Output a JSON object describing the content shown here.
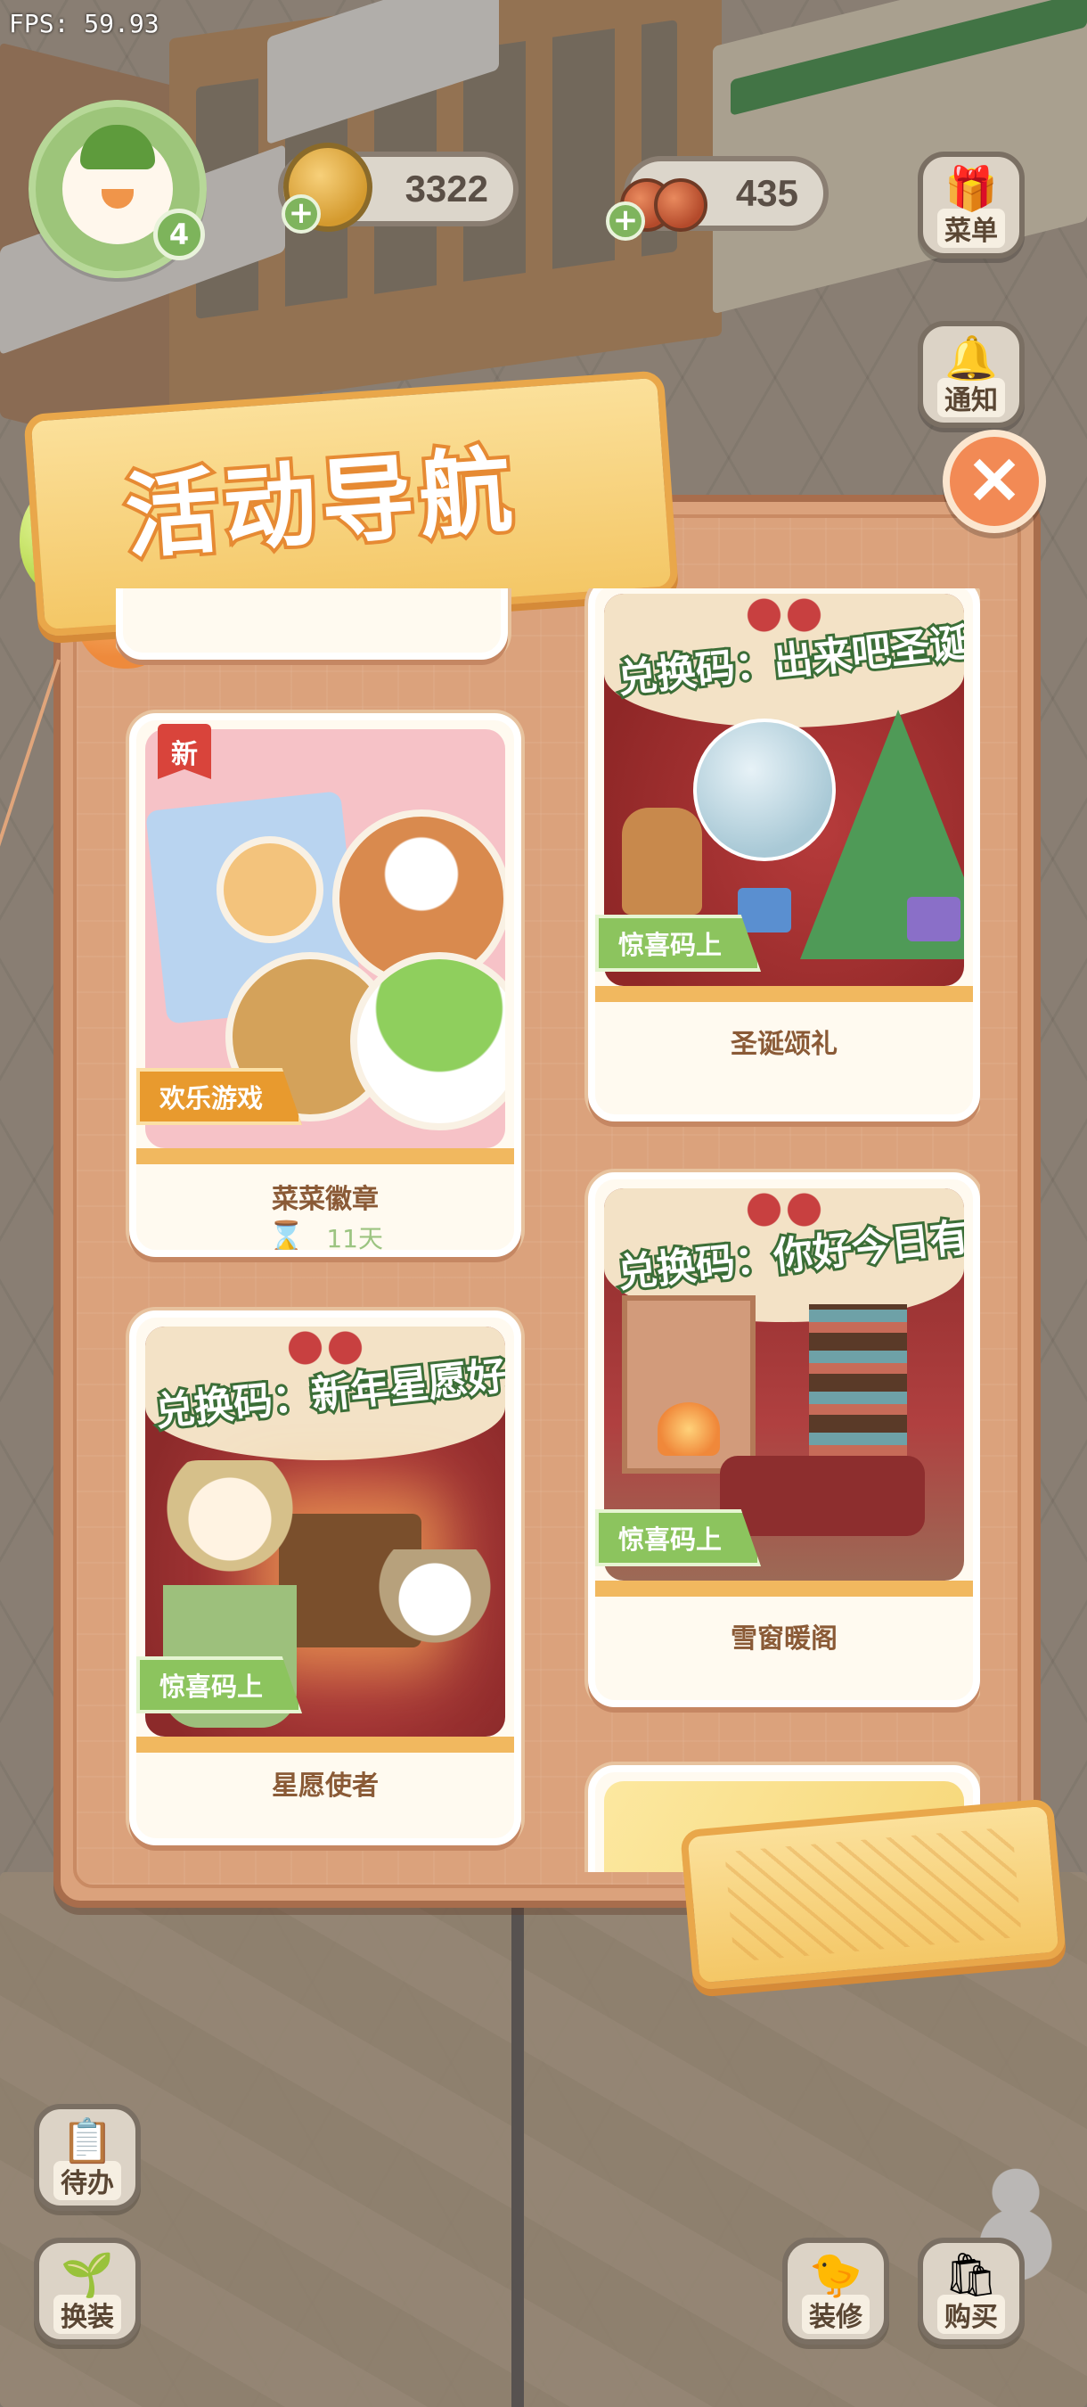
{
  "fps": "FPS: 59.93",
  "player": {
    "level": "4"
  },
  "resources": {
    "coins": "3322",
    "cherries": "435"
  },
  "side_buttons": {
    "menu": "菜单",
    "notice": "通知",
    "todo": "待办",
    "dress": "换装",
    "decor": "装修",
    "buy": "购买"
  },
  "panel": {
    "title": "活动导航",
    "close_symbol": "✕"
  },
  "cards": [
    {
      "badge": "新",
      "tag": "欢乐游戏",
      "name": "菜菜徽章",
      "timer": "11天"
    },
    {
      "banner": "兑换码：出来吧圣诞树",
      "tag": "惊喜码上",
      "name": "圣诞颂礼"
    },
    {
      "banner": "兑换码：新年星愿好心情",
      "tag": "惊喜码上",
      "name": "星愿使者"
    },
    {
      "banner": "兑换码：你好今日有雪",
      "tag": "惊喜码上",
      "name": "雪窗暖阁"
    }
  ],
  "icons": {
    "close": "close-icon",
    "coin": "coin-icon",
    "cherry": "cherry-icon",
    "menu": "gift-menu-icon",
    "notice": "bell-icon",
    "todo": "checklist-icon",
    "dress": "sprout-character-icon",
    "decor": "builder-duck-icon",
    "buy": "shopping-bag-icon",
    "timer": "hourglass-icon"
  },
  "colors": {
    "panel": "#dba27c",
    "ribbon": "#f4c766",
    "tag_green": "#8cc45e",
    "tag_orange": "#e89a2e",
    "close": "#f28a55"
  }
}
